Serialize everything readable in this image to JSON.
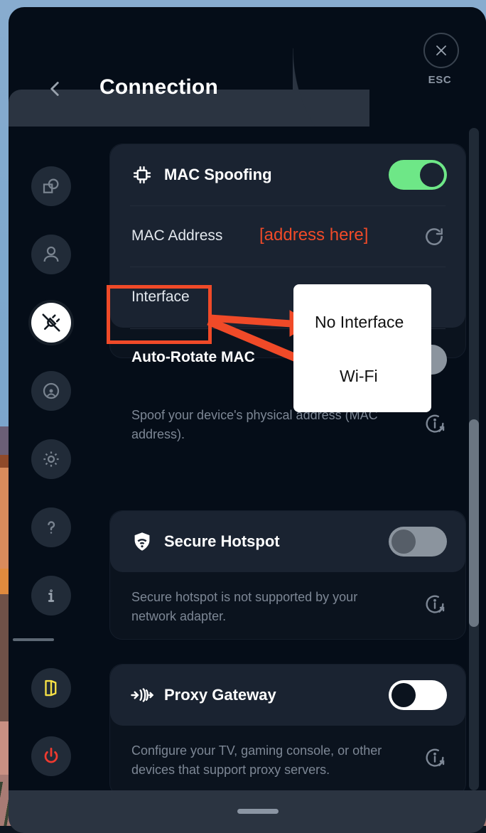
{
  "header": {
    "title": "Connection",
    "back_icon": "chevron-left-icon",
    "close_icon": "close-x-icon",
    "esc_label": "ESC"
  },
  "sidebar": {
    "items": [
      {
        "icon": "shapes-overlap-icon",
        "active": false
      },
      {
        "icon": "person-icon",
        "active": false
      },
      {
        "icon": "plug-disconnect-icon",
        "active": true
      },
      {
        "icon": "target-record-icon",
        "active": false
      },
      {
        "icon": "gear-icon",
        "active": false
      },
      {
        "icon": "question-mark-icon",
        "active": false
      },
      {
        "icon": "info-i-icon",
        "active": false
      }
    ],
    "bottom_items": [
      {
        "icon": "exit-door-icon",
        "color": "#f5e045"
      },
      {
        "icon": "power-icon",
        "color": "#f03a2f"
      }
    ]
  },
  "cards": [
    {
      "title": "MAC Spoofing",
      "icon": "cpu-chip-icon",
      "toggle": {
        "state": "on",
        "style": "green"
      },
      "rows": [
        {
          "label": "MAC Address",
          "value": "[address here]",
          "value_color": "#f04a28",
          "action_icon": "refresh-icon"
        },
        {
          "label": "Interface",
          "value": "",
          "bold": false
        },
        {
          "label": "Auto-Rotate MAC",
          "value": "",
          "bold": true,
          "toggle": {
            "state": "off",
            "style": "grey"
          }
        }
      ],
      "description": "Spoof your device's physical address (MAC address).",
      "info_icon": "info-external-icon"
    },
    {
      "title": "Secure Hotspot",
      "icon": "shield-wifi-icon",
      "toggle": {
        "state": "off",
        "style": "grey"
      },
      "rows": [],
      "description": "Secure hotspot is not supported by your network adapter.",
      "info_icon": "info-external-icon"
    },
    {
      "title": "Proxy Gateway",
      "icon": "signal-broadcast-icon",
      "toggle": {
        "state": "off",
        "style": "white"
      },
      "rows": [],
      "description": "Configure your TV, gaming console, or other devices that support proxy servers.",
      "info_icon": "info-external-icon"
    }
  ],
  "annotation": {
    "highlight_label": "Interface",
    "options": [
      "No Interface",
      "Wi-Fi"
    ],
    "accent_color": "#f04a28"
  },
  "scrollbar": {
    "orientation": "vertical"
  },
  "bottom_bar": {
    "home_indicator": "home-indicator"
  }
}
